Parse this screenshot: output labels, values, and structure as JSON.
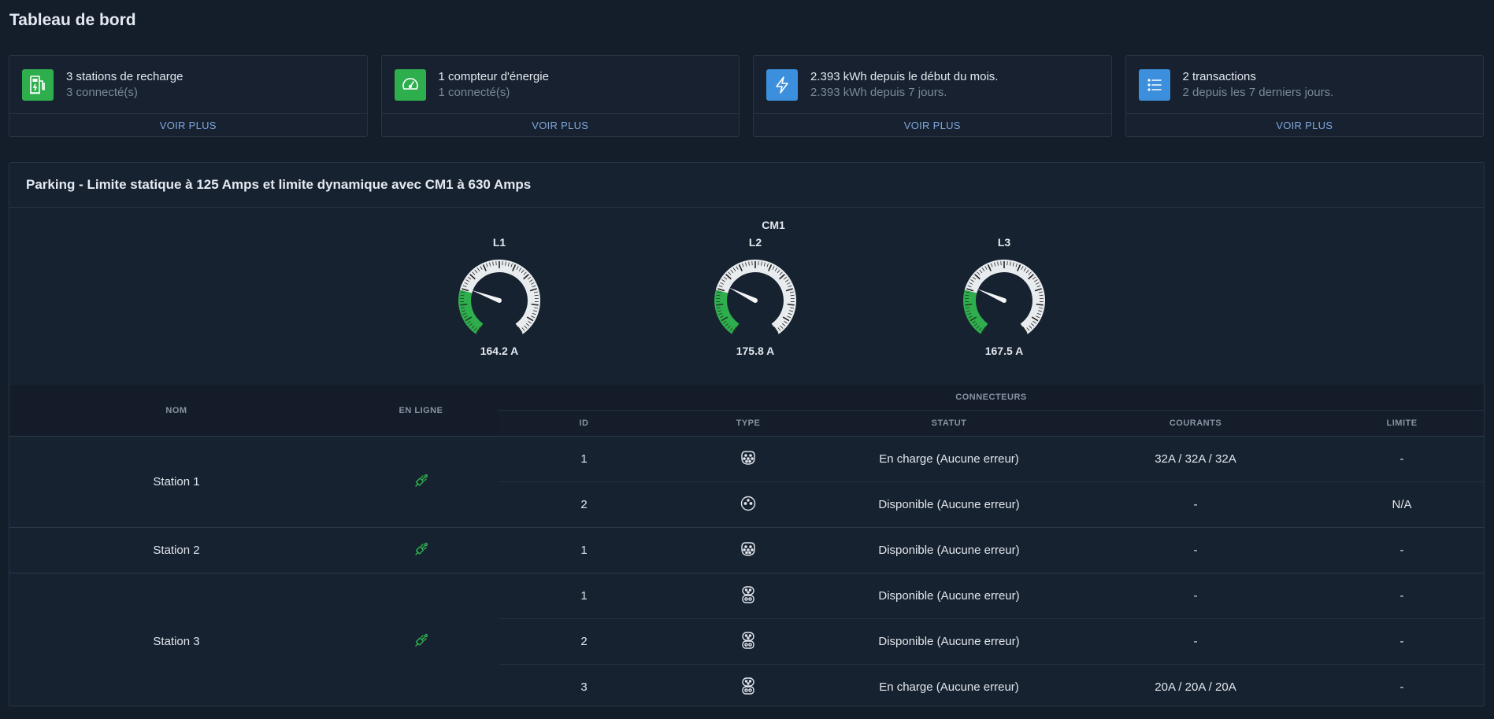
{
  "page": {
    "title": "Tableau de bord"
  },
  "cards": [
    {
      "icon": "charging-station-icon",
      "color": "#2fae4e",
      "line1": "3 stations de recharge",
      "line2": "3 connecté(s)",
      "action": "VOIR PLUS"
    },
    {
      "icon": "speedometer-icon",
      "color": "#2fae4e",
      "line1": "1 compteur d'énergie",
      "line2": "1 connecté(s)",
      "action": "VOIR PLUS"
    },
    {
      "icon": "lightning-icon",
      "color": "#3b8fdc",
      "line1": "2.393 kWh depuis le début du mois.",
      "line2": "2.393 kWh depuis 7 jours.",
      "action": "VOIR PLUS"
    },
    {
      "icon": "list-icon",
      "color": "#3b8fdc",
      "line1": "2 transactions",
      "line2": "2 depuis les 7 derniers jours.",
      "action": "VOIR PLUS"
    }
  ],
  "panel": {
    "title": "Parking - Limite statique à 125 Amps et limite dynamique avec CM1 à 630 Amps",
    "meter_label": "CM1",
    "gauges": [
      {
        "label": "L1",
        "value_text": "164.2 A",
        "fraction": 0.26
      },
      {
        "label": "L2",
        "value_text": "175.8 A",
        "fraction": 0.28
      },
      {
        "label": "L3",
        "value_text": "167.5 A",
        "fraction": 0.27
      }
    ],
    "accent_green": "#2fae4e"
  },
  "table": {
    "headers": {
      "name": "NOM",
      "online": "EN LIGNE",
      "connectors": "CONNECTEURS",
      "id": "ID",
      "type": "TYPE",
      "status": "STATUT",
      "currents": "COURANTS",
      "limit": "LIMITE"
    },
    "stations": [
      {
        "name": "Station 1",
        "online_icon": "plug-connected-icon",
        "connectors": [
          {
            "id": "1",
            "type_icon": "type2-connector-icon",
            "status": "En charge (Aucune erreur)",
            "currents": "32A / 32A / 32A",
            "limit": "-"
          },
          {
            "id": "2",
            "type_icon": "domestic-socket-icon",
            "status": "Disponible (Aucune erreur)",
            "currents": "-",
            "limit": "N/A"
          }
        ]
      },
      {
        "name": "Station 2",
        "online_icon": "plug-connected-icon",
        "connectors": [
          {
            "id": "1",
            "type_icon": "type2-connector-icon",
            "status": "Disponible (Aucune erreur)",
            "currents": "-",
            "limit": "-"
          }
        ]
      },
      {
        "name": "Station 3",
        "online_icon": "plug-connected-icon",
        "connectors": [
          {
            "id": "1",
            "type_icon": "ccs-connector-icon",
            "status": "Disponible (Aucune erreur)",
            "currents": "-",
            "limit": "-"
          },
          {
            "id": "2",
            "type_icon": "ccs-connector-icon",
            "status": "Disponible (Aucune erreur)",
            "currents": "-",
            "limit": "-"
          },
          {
            "id": "3",
            "type_icon": "ccs-connector-icon",
            "status": "En charge (Aucune erreur)",
            "currents": "20A / 20A / 20A",
            "limit": "-"
          }
        ]
      }
    ]
  }
}
